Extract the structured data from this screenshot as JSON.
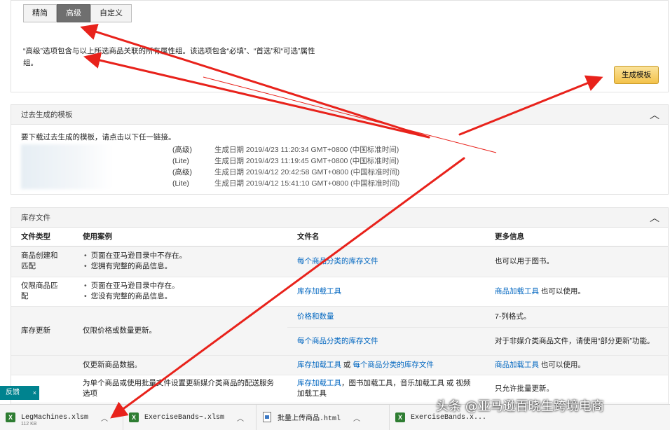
{
  "mode_tabs": [
    "精简",
    "高级",
    "自定义"
  ],
  "description": "“高级”选项包含与以上所选商品关联的所有属性组。该选项包含“必填”、“首选”和“可选”属性组。",
  "generate_button": "生成模板",
  "past_templates": {
    "title": "过去生成的模板",
    "intro": "要下载过去生成的模板，请点击以下任一链接。",
    "rows": [
      {
        "kind": "(高级)",
        "date": "生成日期 2019/4/23 11:20:34 GMT+0800 (中国标准时间)"
      },
      {
        "kind": "(Lite)",
        "date": "生成日期 2019/4/23 11:19:45 GMT+0800 (中国标准时间)"
      },
      {
        "kind": "(高级)",
        "date": "生成日期 2019/4/12 20:42:58 GMT+0800 (中国标准时间)"
      },
      {
        "kind": "(Lite)",
        "date": "生成日期 2019/4/12 15:41:10 GMT+0800 (中国标准时间)"
      }
    ]
  },
  "inventory": {
    "title": "库存文件",
    "headers": [
      "文件类型",
      "使用案例",
      "文件名",
      "更多信息"
    ],
    "r1": {
      "type": "商品创建和匹配",
      "cases": [
        "页面在亚马逊目录中不存在。",
        "您拥有完整的商品信息。"
      ],
      "file": "每个商品分类的库存文件",
      "info": "也可以用于图书。"
    },
    "r2": {
      "type": "仅限商品匹配",
      "cases": [
        "页面在亚马逊目录中存在。",
        "您没有完整的商品信息。"
      ],
      "file": "库存加载工具",
      "info_link": "商品加载工具",
      "info_rest": " 也可以使用。"
    },
    "r3": {
      "type": "库存更新",
      "case": "仅限价格或数量更新。",
      "file": "价格和数量",
      "info": "7-列格式。"
    },
    "r4": {
      "file": "每个商品分类的库存文件",
      "info": "对于非媒介类商品文件，请使用“部分更新”功能。"
    },
    "r5": {
      "case": "仅更新商品数据。",
      "file_a": "库存加载工具",
      "or": " 或 ",
      "file_b": "每个商品分类的库存文件",
      "info_link": "商品加载工具",
      "info_rest": " 也可以使用。"
    },
    "r6": {
      "case": "为单个商品或使用批量文件设置更新媒介类商品的配送服务选项",
      "file_a": "库存加载工具",
      "file_rest": "，图书加载工具，音乐加载工具 或 视频加载工具",
      "info": "只允许批量更新。"
    }
  },
  "feedback": {
    "label": "反馈",
    "close": "×"
  },
  "downloads": [
    {
      "name": "LegMachines.xlsm",
      "sub": "112 KB"
    },
    {
      "name": "ExerciseBands~.xlsm",
      "sub": ""
    },
    {
      "name": "批量上传商品.html",
      "sub": ""
    },
    {
      "name": "ExerciseBands.x...",
      "sub": ""
    }
  ],
  "watermark": "头条 @亚马逊百晓生跨境电商",
  "colors": {
    "annotation_arrow": "#e8221b",
    "link": "#0066c0",
    "generate_button": "#f3c24a"
  }
}
